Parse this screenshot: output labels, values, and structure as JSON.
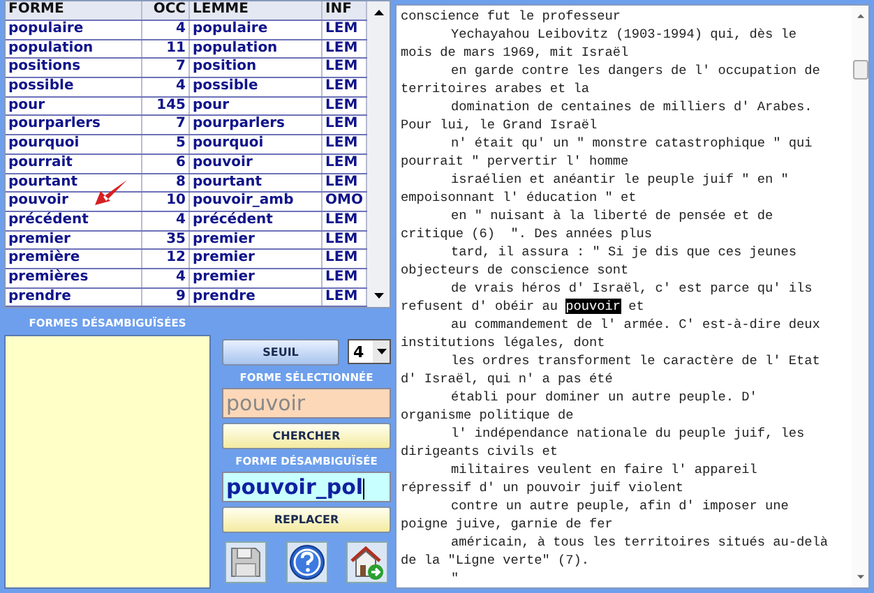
{
  "table": {
    "columns": [
      "FORME",
      "OCC",
      "LEMME",
      "INF"
    ],
    "rows": [
      {
        "forme": "populaire",
        "occ": "4",
        "lemme": "populaire",
        "inf": "LEM",
        "pointed": false
      },
      {
        "forme": "population",
        "occ": "11",
        "lemme": "population",
        "inf": "LEM",
        "pointed": false
      },
      {
        "forme": "positions",
        "occ": "7",
        "lemme": "position",
        "inf": "LEM",
        "pointed": false
      },
      {
        "forme": "possible",
        "occ": "4",
        "lemme": "possible",
        "inf": "LEM",
        "pointed": false
      },
      {
        "forme": "pour",
        "occ": "145",
        "lemme": "pour",
        "inf": "LEM",
        "pointed": false
      },
      {
        "forme": "pourparlers",
        "occ": "7",
        "lemme": "pourparlers",
        "inf": "LEM",
        "pointed": false
      },
      {
        "forme": "pourquoi",
        "occ": "5",
        "lemme": "pourquoi",
        "inf": "LEM",
        "pointed": false
      },
      {
        "forme": "pourrait",
        "occ": "6",
        "lemme": "pouvoir",
        "inf": "LEM",
        "pointed": false
      },
      {
        "forme": "pourtant",
        "occ": "8",
        "lemme": "pourtant",
        "inf": "LEM",
        "pointed": false
      },
      {
        "forme": "pouvoir",
        "occ": "10",
        "lemme": "pouvoir_amb",
        "inf": "OMO",
        "pointed": true
      },
      {
        "forme": "précédent",
        "occ": "4",
        "lemme": "précédent",
        "inf": "LEM",
        "pointed": false
      },
      {
        "forme": "premier",
        "occ": "35",
        "lemme": "premier",
        "inf": "LEM",
        "pointed": false
      },
      {
        "forme": "première",
        "occ": "12",
        "lemme": "premier",
        "inf": "LEM",
        "pointed": false
      },
      {
        "forme": "premières",
        "occ": "4",
        "lemme": "premier",
        "inf": "LEM",
        "pointed": false
      },
      {
        "forme": "prendre",
        "occ": "9",
        "lemme": "prendre",
        "inf": "LEM",
        "pointed": false
      }
    ]
  },
  "disambiguated_list": {
    "title": "FORMES DÉSAMBIGUÏSÉES"
  },
  "controls": {
    "seuil_button": "SEUIL",
    "seuil_value": "4",
    "selected_label": "FORME SÉLECTIONNÉE",
    "selected_value": "pouvoir",
    "search_button": "CHERCHER",
    "disambiguated_label": "FORME DÉSAMBIGUÏSÉE",
    "disambiguated_value": "pouvoir_pol",
    "replace_button": "REPLACER"
  },
  "text_lines": [
    {
      "indented": false,
      "segments": [
        {
          "text": "conscience fut le professeur",
          "selected": false
        }
      ]
    },
    {
      "indented": true,
      "segments": [
        {
          "text": "Yechayahou Leibovitz (1903-1994) qui, dès le",
          "selected": false
        }
      ]
    },
    {
      "indented": false,
      "segments": [
        {
          "text": "mois de mars 1969, mit Israël",
          "selected": false
        }
      ]
    },
    {
      "indented": true,
      "segments": [
        {
          "text": "en garde contre les dangers de l' occupation de",
          "selected": false
        }
      ]
    },
    {
      "indented": false,
      "segments": [
        {
          "text": "territoires arabes et la",
          "selected": false
        }
      ]
    },
    {
      "indented": true,
      "segments": [
        {
          "text": "domination de centaines de milliers d' Arabes.",
          "selected": false
        }
      ]
    },
    {
      "indented": false,
      "segments": [
        {
          "text": "Pour lui, le Grand Israël",
          "selected": false
        }
      ]
    },
    {
      "indented": true,
      "segments": [
        {
          "text": "n' était qu' un \" monstre catastrophique \" qui",
          "selected": false
        }
      ]
    },
    {
      "indented": false,
      "segments": [
        {
          "text": "pourrait \" pervertir l' homme",
          "selected": false
        }
      ]
    },
    {
      "indented": true,
      "segments": [
        {
          "text": "israélien et anéantir le peuple juif \" en \"",
          "selected": false
        }
      ]
    },
    {
      "indented": false,
      "segments": [
        {
          "text": "empoisonnant l' éducation \" et",
          "selected": false
        }
      ]
    },
    {
      "indented": true,
      "segments": [
        {
          "text": "en \" nuisant à la liberté de pensée et de",
          "selected": false
        }
      ]
    },
    {
      "indented": false,
      "segments": [
        {
          "text": "critique (6)  \". Des années plus",
          "selected": false
        }
      ]
    },
    {
      "indented": true,
      "segments": [
        {
          "text": "tard, il assura : \" Si je dis que ces jeunes",
          "selected": false
        }
      ]
    },
    {
      "indented": false,
      "segments": [
        {
          "text": "objecteurs de conscience sont",
          "selected": false
        }
      ]
    },
    {
      "indented": true,
      "segments": [
        {
          "text": "de vrais héros d' Israël, c' est parce qu' ils",
          "selected": false
        }
      ]
    },
    {
      "indented": false,
      "segments": [
        {
          "text": "refusent d' obéir au ",
          "selected": false
        },
        {
          "text": "pouvoir",
          "selected": true
        },
        {
          "text": " et",
          "selected": false
        }
      ]
    },
    {
      "indented": true,
      "segments": [
        {
          "text": "au commandement de l' armée. C' est-à-dire deux",
          "selected": false
        }
      ]
    },
    {
      "indented": false,
      "segments": [
        {
          "text": "institutions légales, dont",
          "selected": false
        }
      ]
    },
    {
      "indented": true,
      "segments": [
        {
          "text": "les ordres transforment le caractère de l' Etat",
          "selected": false
        }
      ]
    },
    {
      "indented": false,
      "segments": [
        {
          "text": "d' Israël, qui n' a pas été",
          "selected": false
        }
      ]
    },
    {
      "indented": true,
      "segments": [
        {
          "text": "établi pour dominer un autre peuple. D'",
          "selected": false
        }
      ]
    },
    {
      "indented": false,
      "segments": [
        {
          "text": "organisme politique de",
          "selected": false
        }
      ]
    },
    {
      "indented": true,
      "segments": [
        {
          "text": "l' indépendance nationale du peuple juif, les",
          "selected": false
        }
      ]
    },
    {
      "indented": false,
      "segments": [
        {
          "text": "dirigeants civils et",
          "selected": false
        }
      ]
    },
    {
      "indented": true,
      "segments": [
        {
          "text": "militaires veulent en faire l' appareil",
          "selected": false
        }
      ]
    },
    {
      "indented": false,
      "segments": [
        {
          "text": "répressif d' un pouvoir juif violent",
          "selected": false
        }
      ]
    },
    {
      "indented": true,
      "segments": [
        {
          "text": "contre un autre peuple, afin d' imposer une",
          "selected": false
        }
      ]
    },
    {
      "indented": false,
      "segments": [
        {
          "text": "poigne juive, garnie de fer",
          "selected": false
        }
      ]
    },
    {
      "indented": true,
      "segments": [
        {
          "text": "américain, à tous les territoires situés au-delà",
          "selected": false
        }
      ]
    },
    {
      "indented": false,
      "segments": [
        {
          "text": "de la \"Ligne verte\" (7).",
          "selected": false
        }
      ]
    },
    {
      "indented": true,
      "segments": [
        {
          "text": "\"",
          "selected": false
        }
      ]
    }
  ]
}
